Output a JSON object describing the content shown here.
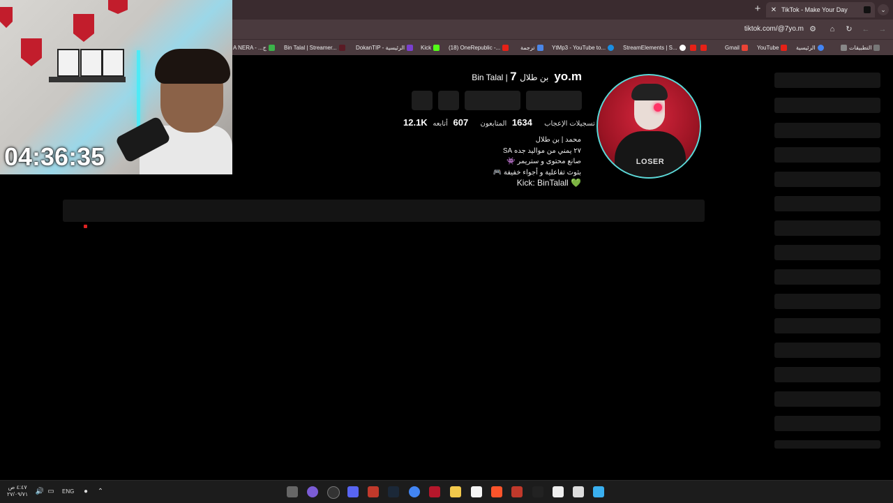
{
  "browser": {
    "tab": {
      "title": "TikTok - Make Your Day",
      "close": "✕"
    },
    "new_tab": "+",
    "tab_list": "⌄",
    "url": "tiktok.com/@7yo.m",
    "bookmarks": [
      "A NERA - ...ج",
      "Bin Talal | Streamer...",
      "DokanTIP - الرئيسية",
      "Kick",
      "(18) OneRepublic -...",
      "ترجمة",
      "YtMp3 - YouTube to...",
      "StreamElements | S...",
      "Gmail",
      "YouTube",
      "الرئيسية",
      "التطبيقات"
    ]
  },
  "overlay": {
    "timer": "04:36:35"
  },
  "profile": {
    "username": "7yo.m",
    "nickname": "Bin Talal | بن طلال",
    "stats": {
      "following": "607",
      "following_label": "أتابعه",
      "followers": "1634",
      "followers_label": "المتابعون",
      "likes": "12.1K",
      "likes_label": "تسجيلات الإعجاب"
    },
    "bio": [
      "محمد | بن طلال",
      "٢٧ يمني من مواليد جده SA",
      "صانع محتوى و ستريمر 👾",
      "بثوث تفاعلية و أجواء خفيفة 🎮",
      "Kick: BinTalall 💚"
    ],
    "avatar_text": "LOSER"
  },
  "taskbar": {
    "time": "٤:٤٧ ص",
    "date": "٢٧/٠٩/٧١",
    "lang": "ENG"
  },
  "colors": {
    "chrome_bg": "#4a3a3e",
    "avatar_ring": "#5ad9d8"
  }
}
